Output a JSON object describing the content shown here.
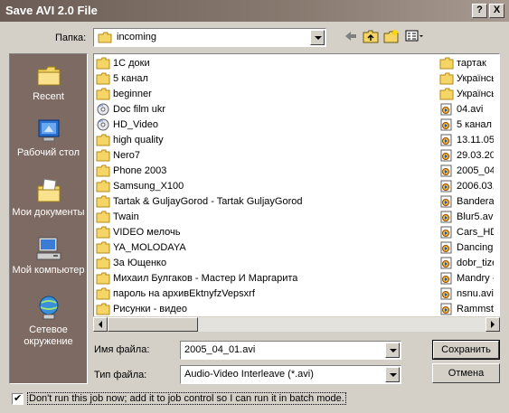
{
  "window": {
    "title": "Save AVI 2.0 File",
    "help_btn": "?",
    "close_btn": "X"
  },
  "lookin": {
    "label": "Папка:",
    "value": "incoming"
  },
  "places": [
    {
      "label": "Recent",
      "icon": "recent-folder-icon"
    },
    {
      "label": "Рабочий стол",
      "icon": "desktop-icon"
    },
    {
      "label": "Мои документы",
      "icon": "my-documents-icon"
    },
    {
      "label": "Мой компьютер",
      "icon": "my-computer-icon"
    },
    {
      "label": "Сетевое окружение",
      "icon": "network-icon"
    }
  ],
  "files_col1": [
    {
      "name": "1С доки",
      "type": "folder"
    },
    {
      "name": "5 канал",
      "type": "folder"
    },
    {
      "name": "beginner",
      "type": "folder"
    },
    {
      "name": "Doc film ukr",
      "type": "disc"
    },
    {
      "name": "HD_Video",
      "type": "disc"
    },
    {
      "name": "high quality",
      "type": "folder"
    },
    {
      "name": "Nero7",
      "type": "folder"
    },
    {
      "name": "Phone 2003",
      "type": "folder"
    },
    {
      "name": "Samsung_X100",
      "type": "folder"
    },
    {
      "name": "Tartak & GuljayGorod - Tartak GuljayGorod",
      "type": "folder"
    },
    {
      "name": "Twain",
      "type": "folder"
    },
    {
      "name": "VIDEO мелочь",
      "type": "folder"
    },
    {
      "name": "YA_MOLODAYA",
      "type": "folder"
    },
    {
      "name": "За Ющенко",
      "type": "folder"
    },
    {
      "name": "Михаил Булгаков - Мастер И Маргарита",
      "type": "folder"
    },
    {
      "name": "пароль на архивEktnyfzVepsxrf",
      "type": "folder"
    },
    {
      "name": "Рисунки - видео",
      "type": "folder"
    }
  ],
  "files_col2": [
    {
      "name": "тартак",
      "type": "folder"
    },
    {
      "name": "Українсь",
      "type": "folder"
    },
    {
      "name": "Українсь",
      "type": "folder"
    },
    {
      "name": "04.avi",
      "type": "avi"
    },
    {
      "name": "5 канал -",
      "type": "avi"
    },
    {
      "name": "13.11.05_",
      "type": "avi"
    },
    {
      "name": "29.03.200",
      "type": "avi"
    },
    {
      "name": "2005_04_",
      "type": "avi"
    },
    {
      "name": "2006.03.2",
      "type": "avi"
    },
    {
      "name": "Bandera.a",
      "type": "avi"
    },
    {
      "name": "Blur5.avi",
      "type": "avi"
    },
    {
      "name": "Cars_HD_",
      "type": "avi"
    },
    {
      "name": "Dancing I",
      "type": "avi"
    },
    {
      "name": "dobr_tizer",
      "type": "avi"
    },
    {
      "name": "Mandry - I",
      "type": "avi"
    },
    {
      "name": "nsnu.avi",
      "type": "avi"
    },
    {
      "name": "Rammstei",
      "type": "avi"
    }
  ],
  "filename": {
    "label": "Имя файла:",
    "value": "2005_04_01.avi"
  },
  "filetype": {
    "label": "Тип файла:",
    "value": "Audio-Video Interleave (*.avi)"
  },
  "buttons": {
    "save": "Сохранить",
    "cancel": "Отмена"
  },
  "batch": {
    "checked": true,
    "label": "Don't run this job now; add it to job control so I can run it in batch mode."
  },
  "colors": {
    "places_bg": "#7d6b63",
    "title_gradient": "#6b5d55",
    "dialog_bg": "#d4d0c8"
  }
}
